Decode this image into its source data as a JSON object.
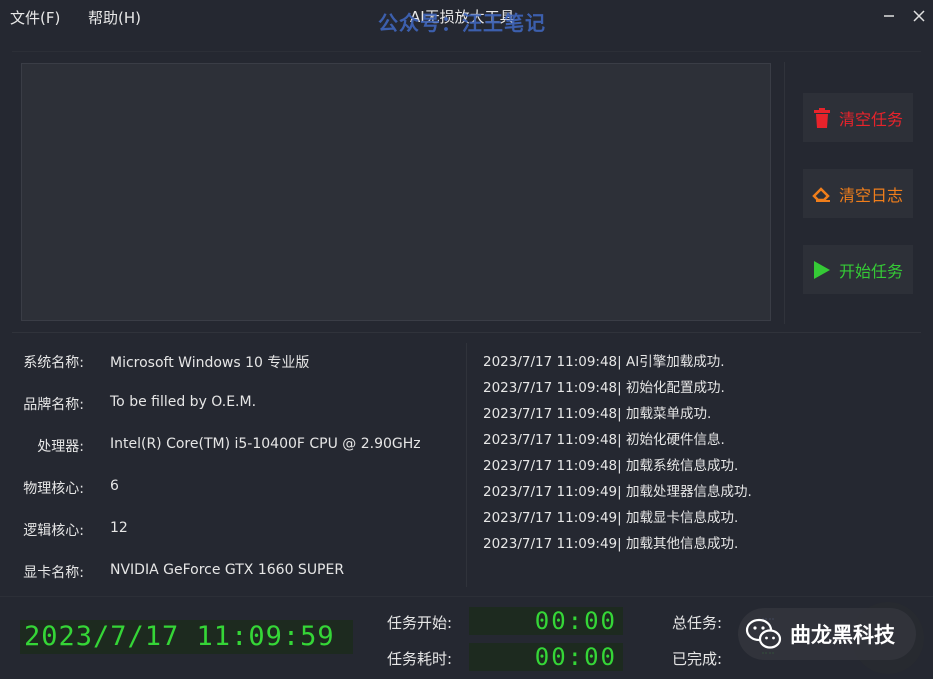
{
  "menu": {
    "file": "文件(F)",
    "help": "帮助(H)"
  },
  "window": {
    "title": "AI无损放大工具",
    "watermark": "公众号：汪王笔记"
  },
  "actions": {
    "clear_tasks": "清空任务",
    "clear_log": "清空日志",
    "start_task": "开始任务",
    "colors": {
      "clear_tasks": "#e8232b",
      "clear_log": "#f07e1b",
      "start_task": "#35c936"
    }
  },
  "system_info": [
    {
      "label": "系统名称:",
      "value": "Microsoft Windows 10 专业版"
    },
    {
      "label": "品牌名称:",
      "value": "To be filled by O.E.M."
    },
    {
      "label": "处理器:",
      "value": "Intel(R) Core(TM) i5-10400F CPU @ 2.90GHz"
    },
    {
      "label": "物理核心:",
      "value": "6"
    },
    {
      "label": "逻辑核心:",
      "value": "12"
    },
    {
      "label": "显卡名称:",
      "value": "NVIDIA GeForce GTX 1660 SUPER"
    }
  ],
  "log": [
    "2023/7/17 11:09:48| AI引擎加载成功.",
    "2023/7/17 11:09:48| 初始化配置成功.",
    "2023/7/17 11:09:48| 加载菜单成功.",
    "2023/7/17 11:09:48| 初始化硬件信息.",
    "2023/7/17 11:09:48| 加载系统信息成功.",
    "2023/7/17 11:09:49| 加载处理器信息成功.",
    "2023/7/17 11:09:49| 加载显卡信息成功.",
    "2023/7/17 11:09:49| 加载其他信息成功."
  ],
  "status": {
    "clock": "2023/7/17 11:09:59",
    "task_start_label": "任务开始:",
    "task_start_value": "00:00",
    "task_elapsed_label": "任务耗时:",
    "task_elapsed_value": "00:00",
    "total_tasks_label": "总任务:",
    "completed_label": "已完成:"
  },
  "badge": {
    "text": "曲龙黑科技"
  }
}
